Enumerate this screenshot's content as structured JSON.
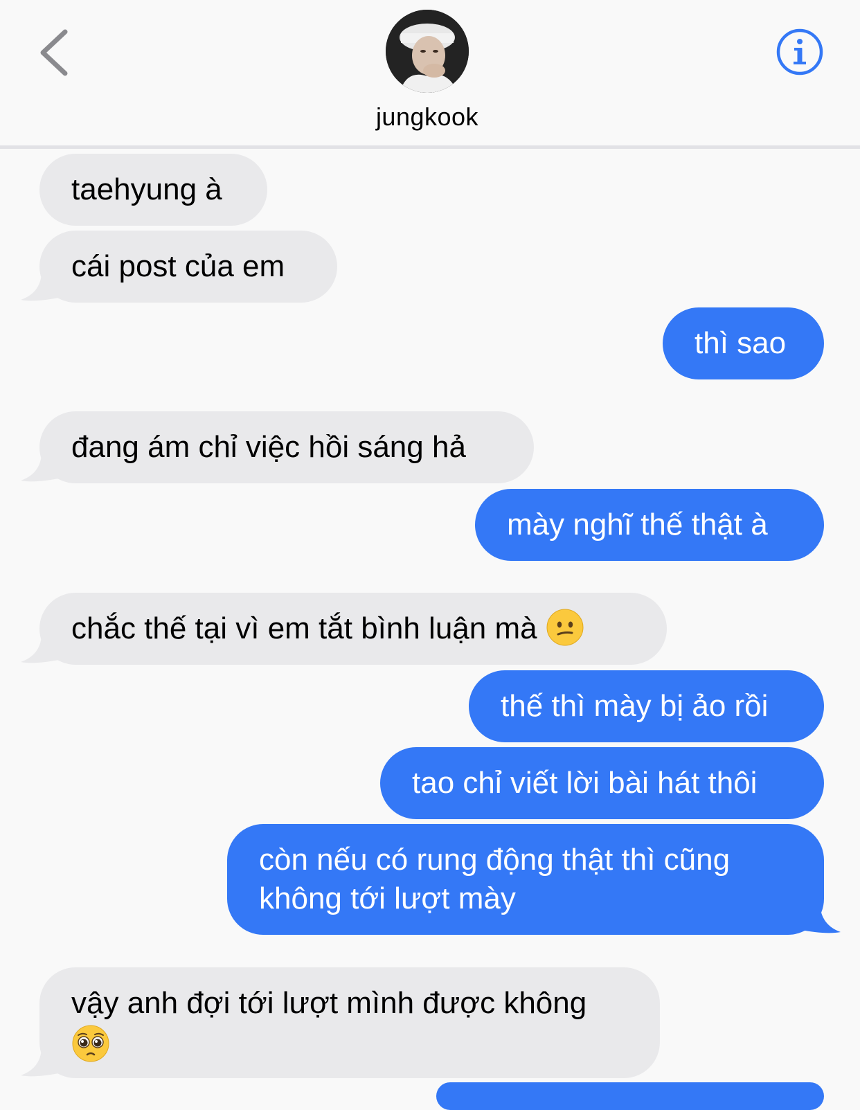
{
  "header": {
    "contact_name": "jungkook",
    "back_icon": "chevron-left-icon",
    "info_icon": "info-icon"
  },
  "colors": {
    "incoming_bubble": "#e9e9eb",
    "outgoing_bubble": "#3478f6",
    "accent": "#3478f6"
  },
  "messages": [
    {
      "direction": "incoming",
      "text": "taehyung à"
    },
    {
      "direction": "incoming",
      "text": "cái post của em"
    },
    {
      "direction": "outgoing",
      "text": "thì sao"
    },
    {
      "direction": "incoming",
      "text": "đang ám chỉ việc hồi sáng hả"
    },
    {
      "direction": "outgoing",
      "text": "mày nghĩ thế thật à"
    },
    {
      "direction": "incoming",
      "text": "chắc thế tại vì em tắt bình luận mà",
      "emoji": "neutral-face-emoji"
    },
    {
      "direction": "outgoing",
      "text": "thế thì mày bị ảo rồi"
    },
    {
      "direction": "outgoing",
      "text": "tao chỉ viết lời bài hát thôi"
    },
    {
      "direction": "outgoing",
      "line1": "còn nếu có rung động thật thì cũng",
      "line2": "không tới lượt mày"
    },
    {
      "direction": "incoming",
      "line1": "vậy anh đợi tới lượt mình được không",
      "emoji": "pleading-face-emoji"
    }
  ]
}
